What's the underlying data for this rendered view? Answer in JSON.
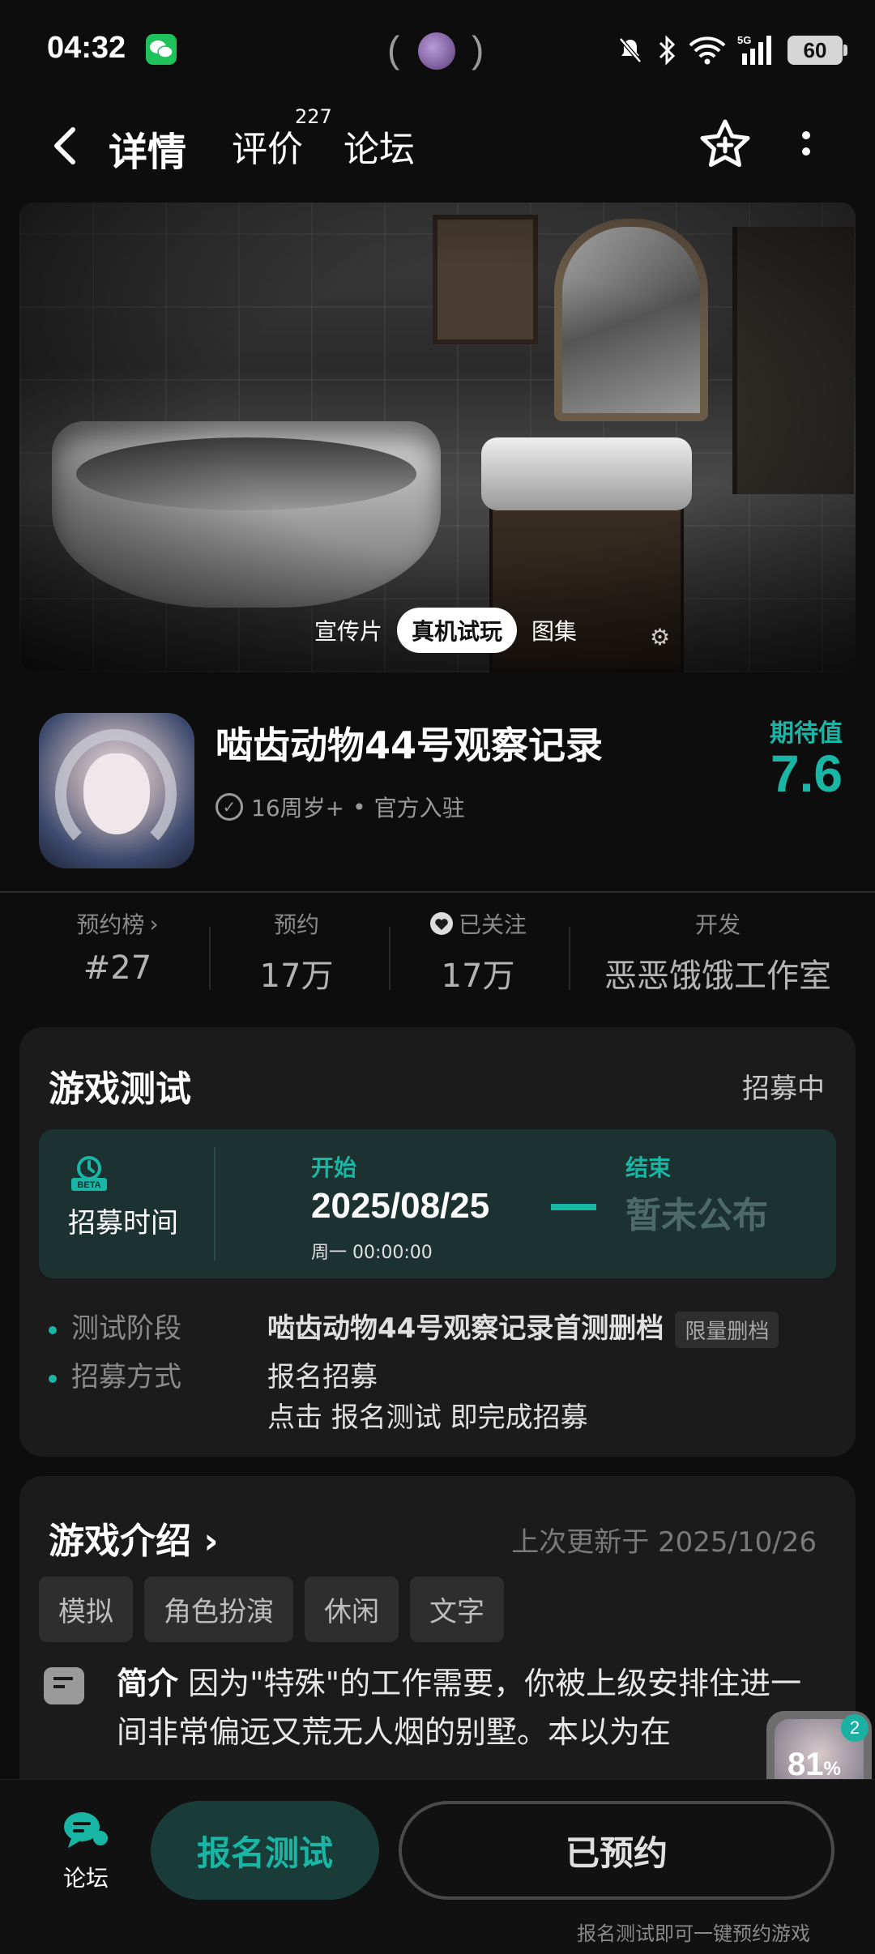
{
  "status_bar": {
    "time": "04:32",
    "battery": "60",
    "network": "5G"
  },
  "nav": {
    "tab_detail": "详情",
    "tab_review": "评价",
    "review_count": "227",
    "tab_forum": "论坛"
  },
  "banner": {
    "media_tabs": [
      "宣传片",
      "真机试玩",
      "图集"
    ],
    "active_media_tab": "真机试玩"
  },
  "game": {
    "title": "啮齿动物44号观察记录",
    "age_rating": "16周岁+",
    "official": "官方入驻",
    "expect_label": "期待值",
    "expect_value": "7.6"
  },
  "stats": [
    {
      "label": "预约榜",
      "value": "#27"
    },
    {
      "label": "预约",
      "value": "17万"
    },
    {
      "label": "已关注",
      "value": "17万"
    },
    {
      "label": "开发",
      "value": "恶恶饿饿工作室"
    }
  ],
  "test": {
    "title": "游戏测试",
    "status": "招募中",
    "recruit_time_label": "招募时间",
    "start_label": "开始",
    "start_date": "2025/08/25",
    "start_sub": "周一  00:00:00",
    "end_label": "结束",
    "end_value": "暂未公布",
    "stage_label": "测试阶段",
    "stage_value": "啮齿动物44号观察记录首测删档",
    "stage_tag": "限量删档",
    "method_label": "招募方式",
    "method_value": "报名招募",
    "method_hint": "点击 报名测试 即完成招募"
  },
  "intro": {
    "title": "游戏介绍",
    "updated": "上次更新于 2025/10/26",
    "tags": [
      "模拟",
      "角色扮演",
      "休闲",
      "文字"
    ],
    "summary_label": "简介",
    "summary_text": "因为\"特殊\"的工作需要，你被上级安排住进一间非常偏远又荒无人烟的别墅。本以为在"
  },
  "float_widget": {
    "percent": "81",
    "percent_unit": "%",
    "badge": "2"
  },
  "bottom": {
    "forum_label": "论坛",
    "signup_label": "报名测试",
    "reserved_label": "已预约",
    "hint": "报名测试即可一键预约游戏"
  },
  "colors": {
    "accent": "#19b6a5",
    "background": "#0d0d0d",
    "card": "#1b1b1b"
  },
  "icons": [
    "back-arrow-icon",
    "star-add-icon",
    "more-vertical-icon",
    "verified-check-icon",
    "heart-icon",
    "beta-timer-icon",
    "forum-chat-icon",
    "settings-gear-icon"
  ]
}
